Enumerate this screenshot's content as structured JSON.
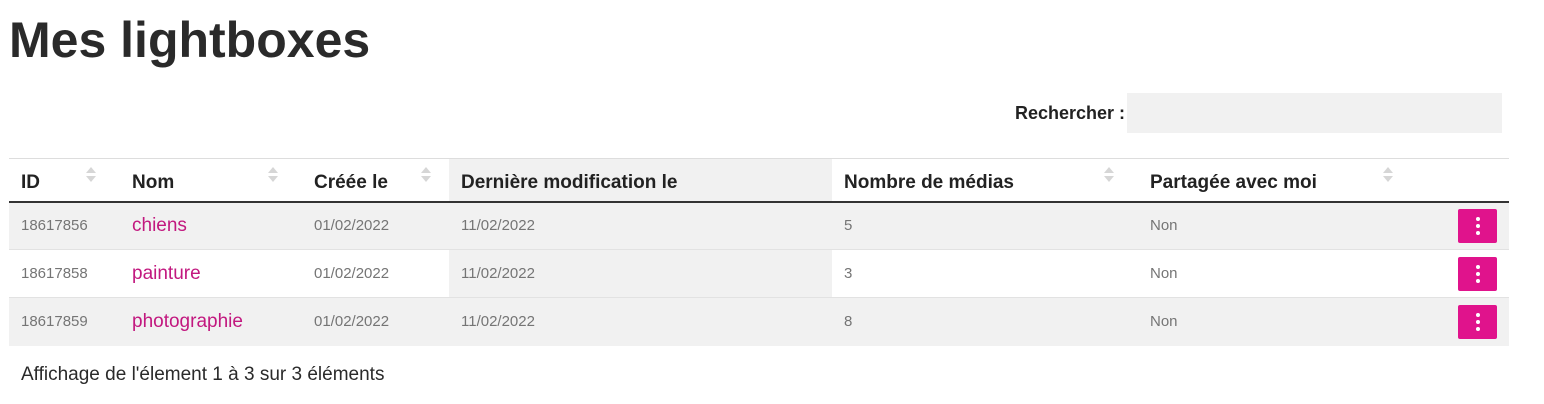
{
  "page": {
    "title": "Mes lightboxes"
  },
  "search": {
    "label": "Rechercher :",
    "value": "",
    "placeholder": ""
  },
  "table": {
    "columns": [
      {
        "label": "ID",
        "sortable": true
      },
      {
        "label": "Nom",
        "sortable": true
      },
      {
        "label": "Créée le",
        "sortable": true
      },
      {
        "label": "Dernière modification le",
        "sortable": true,
        "sorted": true
      },
      {
        "label": "Nombre de médias",
        "sortable": true
      },
      {
        "label": "Partagée avec moi",
        "sortable": true
      },
      {
        "label": "",
        "sortable": false
      }
    ],
    "rows": [
      {
        "id": "18617856",
        "name": "chiens",
        "created": "01/02/2022",
        "modified": "11/02/2022",
        "media_count": "5",
        "shared": "Non"
      },
      {
        "id": "18617858",
        "name": "painture",
        "created": "01/02/2022",
        "modified": "11/02/2022",
        "media_count": "3",
        "shared": "Non"
      },
      {
        "id": "18617859",
        "name": "photographie",
        "created": "01/02/2022",
        "modified": "11/02/2022",
        "media_count": "8",
        "shared": "Non"
      }
    ]
  },
  "footer": {
    "info": "Affichage de l'élement 1 à 3 sur 3 éléments"
  },
  "colors": {
    "accent": "#e0138c",
    "link": "#c2187f",
    "stripe": "#f1f1f1"
  },
  "icons": {
    "row_menu": "vertical-ellipsis-icon",
    "sort": "sort-arrows-icon"
  }
}
